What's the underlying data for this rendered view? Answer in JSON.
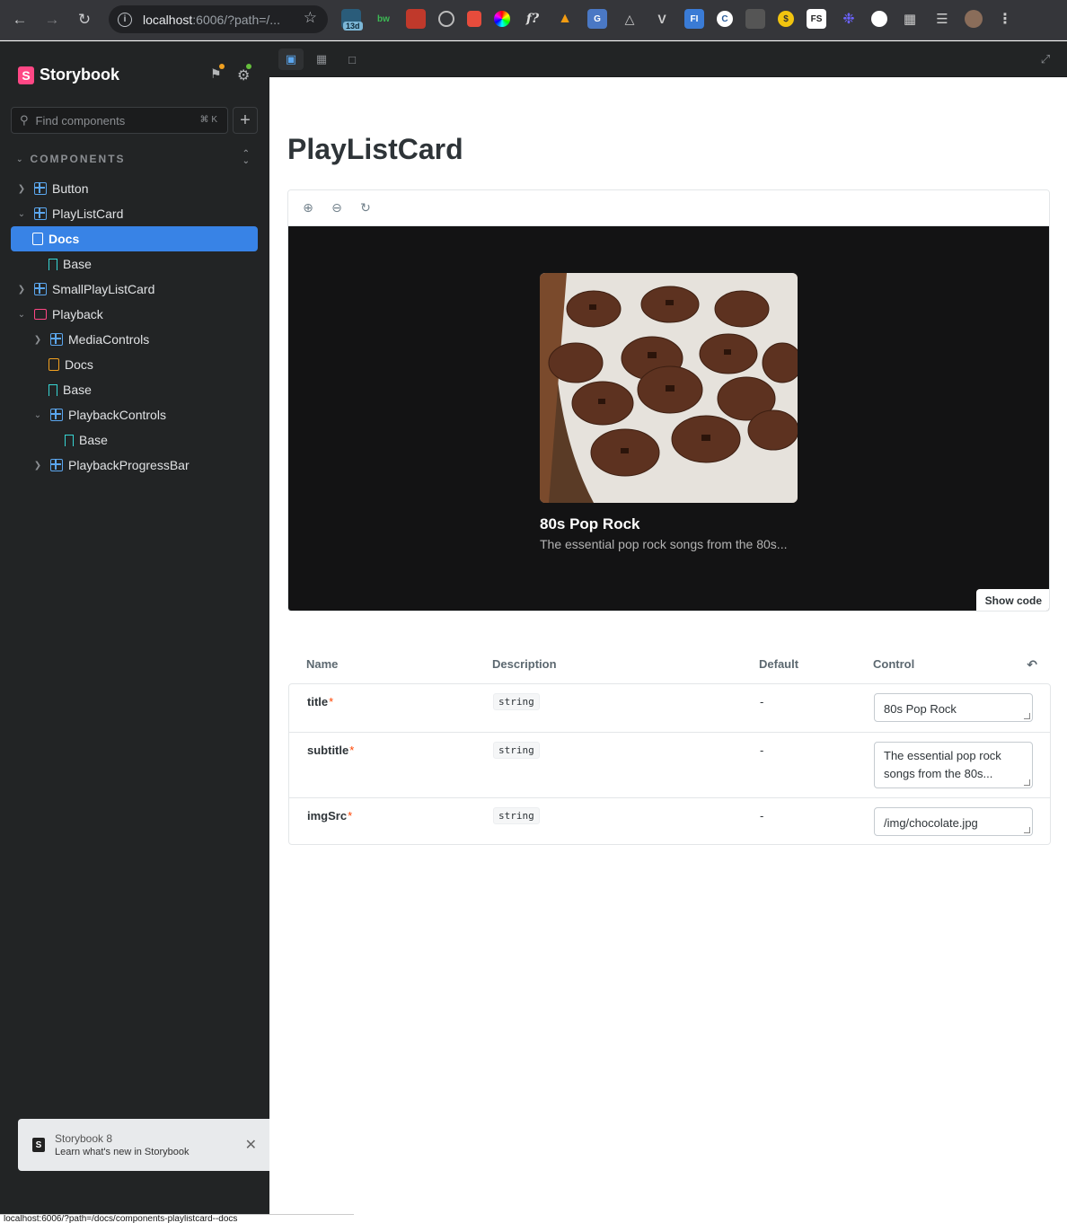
{
  "browser": {
    "url_host": "localhost",
    "url_path": ":6006/?path=/...",
    "badge": "13d",
    "status_url": "localhost:6006/?path=/docs/components-playlistcard--docs"
  },
  "sidebar": {
    "brand": "Storybook",
    "search_placeholder": "Find components",
    "search_shortcut": "⌘ K",
    "section_label": "COMPONENTS",
    "items": [
      {
        "label": "Button",
        "icon": "component-icon"
      },
      {
        "label": "PlayListCard",
        "icon": "component-icon"
      },
      {
        "label": "Docs",
        "icon": "docs-icon"
      },
      {
        "label": "Base",
        "icon": "story-icon"
      },
      {
        "label": "SmallPlayListCard",
        "icon": "component-icon"
      },
      {
        "label": "Playback",
        "icon": "folder-icon"
      },
      {
        "label": "MediaControls",
        "icon": "component-icon"
      },
      {
        "label": "Docs",
        "icon": "docs-icon"
      },
      {
        "label": "Base",
        "icon": "story-icon"
      },
      {
        "label": "PlaybackControls",
        "icon": "component-icon"
      },
      {
        "label": "Base",
        "icon": "story-icon"
      },
      {
        "label": "PlaybackProgressBar",
        "icon": "component-icon"
      }
    ],
    "toast": {
      "title": "Storybook 8",
      "subtitle": "Learn what's new in Storybook"
    }
  },
  "docs": {
    "title": "PlayListCard",
    "preview": {
      "card_title": "80s Pop Rock",
      "card_subtitle": "The essential pop rock songs from the 80s...",
      "show_code_label": "Show code"
    },
    "table": {
      "headers": {
        "name": "Name",
        "description": "Description",
        "default": "Default",
        "control": "Control"
      },
      "rows": [
        {
          "name": "title",
          "type": "string",
          "default": "-",
          "value": "80s Pop Rock"
        },
        {
          "name": "subtitle",
          "type": "string",
          "default": "-",
          "value": "The essential pop rock songs from the 80s..."
        },
        {
          "name": "imgSrc",
          "type": "string",
          "default": "-",
          "value": "/img/chocolate.jpg"
        }
      ],
      "required_marker": "*"
    }
  },
  "colors": {
    "sidebar_bg": "#222425",
    "accent": "#3883e6",
    "brand_pink": "#ff4785",
    "stage_bg": "#131314"
  }
}
